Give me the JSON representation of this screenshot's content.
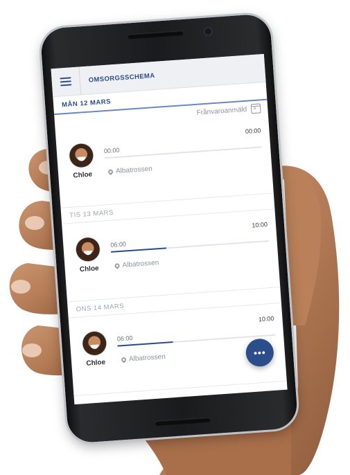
{
  "app": {
    "title": "OMSORGSSCHEMA",
    "menu_icon": "menu-icon"
  },
  "days": [
    {
      "label": "MÅN 12 MARS",
      "absence_label": "Frånvaroanmäld",
      "absence_icon": "calendar-cancel-icon",
      "entry": {
        "child_name": "Chloe",
        "start_time": "00:00",
        "end_time": "00:00",
        "location": "Albatrossen",
        "progress": 0
      }
    },
    {
      "label": "TIS 13 MARS",
      "entry": {
        "child_name": "Chloe",
        "start_time": "06:00",
        "end_time": "10:00",
        "location": "Albatrossen",
        "progress": 0.35
      }
    },
    {
      "label": "ONS 14 MARS",
      "entry": {
        "child_name": "Chloe",
        "start_time": "06:00",
        "end_time": "10:00",
        "location": "Albatrossen",
        "progress": 0.35
      }
    }
  ],
  "fab": {
    "label": "•••",
    "icon": "more-icon"
  },
  "colors": {
    "accent": "#2b4d8a",
    "muted_text": "#8d939b",
    "appbar_bg": "#eef0f3"
  }
}
